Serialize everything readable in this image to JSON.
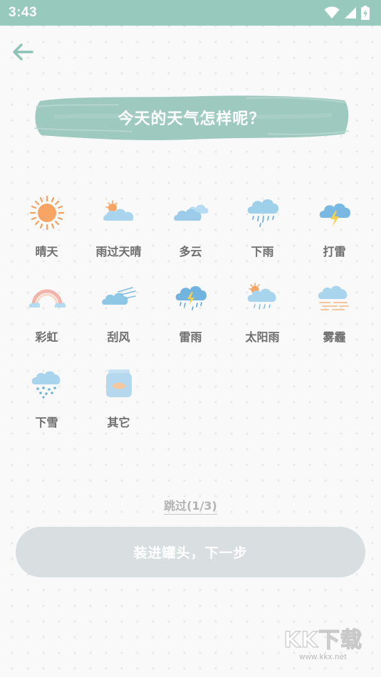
{
  "status_bar": {
    "time": "3:43",
    "icons": [
      "wifi-icon",
      "cellular-signal-icon",
      "battery-charging-icon"
    ]
  },
  "header": {
    "back_icon": "arrow-left-icon"
  },
  "title": "今天的天气怎样呢？",
  "weather_options": [
    {
      "label": "晴天",
      "icon": "sun-icon"
    },
    {
      "label": "雨过天晴",
      "icon": "sun-behind-cloud-icon"
    },
    {
      "label": "多云",
      "icon": "clouds-icon"
    },
    {
      "label": "下雨",
      "icon": "rain-icon"
    },
    {
      "label": "打雷",
      "icon": "thunder-icon"
    },
    {
      "label": "彩虹",
      "icon": "rainbow-icon"
    },
    {
      "label": "刮风",
      "icon": "wind-icon"
    },
    {
      "label": "雷雨",
      "icon": "thunderstorm-icon"
    },
    {
      "label": "太阳雨",
      "icon": "sun-shower-icon"
    },
    {
      "label": "雾霾",
      "icon": "smog-icon"
    },
    {
      "label": "下雪",
      "icon": "snow-icon"
    },
    {
      "label": "其它",
      "icon": "jar-icon"
    }
  ],
  "skip_label": "跳过(1/3)",
  "next_button_label": "装进罐头，下一步",
  "watermark": {
    "logo": "KK下载",
    "url": "www.kkx.net"
  },
  "colors": {
    "status_bar": "#98c9bd",
    "banner": "#9ec9bf",
    "accent": "#7bb8a8",
    "button_disabled": "#d9dee0",
    "label_text": "#6d6d6d"
  }
}
